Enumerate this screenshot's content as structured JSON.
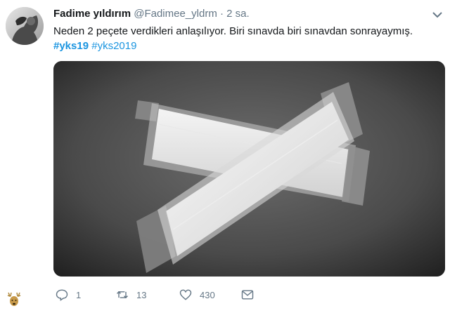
{
  "tweet": {
    "display_name": "Fadime yıldırım",
    "handle": "@Fadimee_yldrm",
    "separator": "·",
    "time": "2 sa.",
    "text": "Neden 2 peçete verdikleri anlaşılıyor. Biri sınavda biri sınavdan sonrayaymış.",
    "hashtags": [
      "#yks19",
      "#yks2019"
    ]
  },
  "actions": {
    "reply_count": "1",
    "retweet_count": "13",
    "like_count": "430"
  },
  "icons": {
    "reply": "reply-icon",
    "retweet": "retweet-icon",
    "like": "heart-icon",
    "message": "envelope-icon",
    "more": "chevron-down-icon",
    "watermark": "deer-icon"
  },
  "colors": {
    "link": "#1b95e0",
    "muted": "#657786",
    "text": "#14171a"
  }
}
